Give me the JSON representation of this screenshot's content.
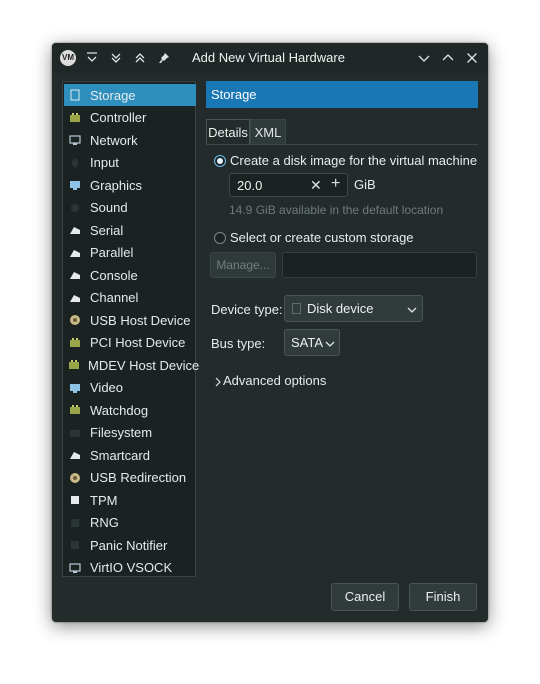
{
  "window": {
    "app_icon": "vm-icon",
    "title": "Add New Virtual Hardware"
  },
  "sidebar": {
    "items": [
      {
        "label": "Storage",
        "icon": "disk-icon",
        "active": true
      },
      {
        "label": "Controller",
        "icon": "chip-icon"
      },
      {
        "label": "Network",
        "icon": "network-icon"
      },
      {
        "label": "Input",
        "icon": "input-icon"
      },
      {
        "label": "Graphics",
        "icon": "monitor-icon"
      },
      {
        "label": "Sound",
        "icon": "sound-icon"
      },
      {
        "label": "Serial",
        "icon": "serial-icon"
      },
      {
        "label": "Parallel",
        "icon": "parallel-icon"
      },
      {
        "label": "Console",
        "icon": "console-icon"
      },
      {
        "label": "Channel",
        "icon": "channel-icon"
      },
      {
        "label": "USB Host Device",
        "icon": "usb-icon"
      },
      {
        "label": "PCI Host Device",
        "icon": "pci-icon"
      },
      {
        "label": "MDEV Host Device",
        "icon": "mdev-icon"
      },
      {
        "label": "Video",
        "icon": "video-icon"
      },
      {
        "label": "Watchdog",
        "icon": "watchdog-icon"
      },
      {
        "label": "Filesystem",
        "icon": "folder-icon"
      },
      {
        "label": "Smartcard",
        "icon": "smartcard-icon"
      },
      {
        "label": "USB Redirection",
        "icon": "usb-redirection-icon"
      },
      {
        "label": "TPM",
        "icon": "tpm-icon"
      },
      {
        "label": "RNG",
        "icon": "rng-icon"
      },
      {
        "label": "Panic Notifier",
        "icon": "panic-icon"
      },
      {
        "label": "VirtIO VSOCK",
        "icon": "vsock-icon"
      }
    ]
  },
  "page": {
    "header": "Storage",
    "tabs": {
      "details": "Details",
      "xml": "XML"
    },
    "create_disk_label": "Create a disk image for the virtual machine",
    "size_value": "20.0",
    "size_unit": "GiB",
    "available_hint": "14.9 GiB available in the default location",
    "custom_storage_label": "Select or create custom storage",
    "manage_label": "Manage...",
    "path_value": "",
    "device_type_label": "Device type:",
    "device_type_value": "Disk device",
    "bus_type_label": "Bus type:",
    "bus_type_value": "SATA",
    "advanced_label": "Advanced options"
  },
  "footer": {
    "cancel_label": "Cancel",
    "finish_label": "Finish"
  },
  "colors": {
    "window_bg": "#232b2b",
    "accent": "#2e8fbf",
    "header_bar": "#1978b4"
  }
}
